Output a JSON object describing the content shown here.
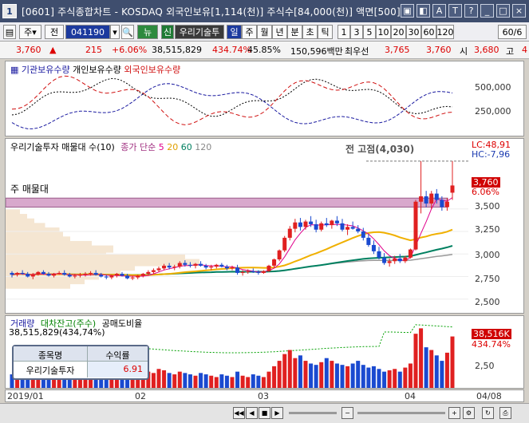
{
  "window": {
    "title": "[0601] 주식종합차트 - KOSDAQ 외국인보유[1,114(천)] 주식수[84,000(천)] 액면[500]",
    "app_badge": "1",
    "buttons": [
      "▣",
      "◧",
      "A",
      "T",
      "?",
      "_",
      "□",
      "×"
    ]
  },
  "toolbar": {
    "market": "주",
    "period_type": "전",
    "code": "041190",
    "name_badge": "뉴",
    "shin": "신",
    "stock_name": "우리기술투",
    "intervals": [
      "일",
      "주",
      "월",
      "년",
      "분",
      "초",
      "틱"
    ],
    "numbers": [
      "1",
      "3",
      "5",
      "10",
      "20",
      "30",
      "60",
      "120"
    ],
    "count": "60/6"
  },
  "info": {
    "price": "3,760",
    "arrow": "▲",
    "change": "215",
    "pct": "+6.06%",
    "volume": "38,515,829",
    "vol_ratio": "434.74%",
    "rate": "45.85%",
    "amount": "150,596백만",
    "priority_label": "최우선",
    "ask": "3,765",
    "bid": "3,760",
    "open_label": "시",
    "open": "3,680",
    "high_label": "고",
    "high": "4"
  },
  "ownership": {
    "legend_inst": "기관보유수량",
    "legend_indiv": "개인보유수량",
    "legend_foreign": "외국인보유수량",
    "y_ticks": [
      "500,000",
      "250,000"
    ],
    "colors": {
      "inst": "#1a1aa0",
      "indiv": "#000000",
      "foreign": "#d01010"
    }
  },
  "price_panel": {
    "legend_name": "우리기술투자 매물대 수(10)",
    "legend_ma": "종가 단순",
    "ma_periods": [
      "5",
      "20",
      "60",
      "120"
    ],
    "ma_colors": [
      "#e0008c",
      "#f0b000",
      "#008060",
      "#888888"
    ],
    "prev_high": "전 고점(4,030)",
    "lc": "LC:48,91",
    "hc": "HC:-7,96",
    "highlight_label": "주 매물대",
    "current_price": "3,760",
    "current_pct": "6.06%",
    "y_ticks": [
      "3,500",
      "3,250",
      "3,000",
      "2,750",
      "2,500"
    ]
  },
  "volume_panel": {
    "legend_vol": "거래량",
    "legend_loan": "대차잔고(주수)",
    "legend_short": "공매도비율",
    "vol_summary": "38,515,829(434,74%)",
    "current_vol": "38,516K",
    "current_pct": "434.74%",
    "y_tick": "2,50",
    "table_header": [
      "종목명",
      "수익률"
    ],
    "table_row": [
      "우리기술투자",
      "6.91"
    ]
  },
  "x_axis": [
    "2019/01",
    "02",
    "03",
    "04",
    "04/08"
  ],
  "chart_data": {
    "type": "candlestick",
    "ohlc": [
      [
        2790,
        2810,
        2740,
        2770
      ],
      [
        2770,
        2800,
        2750,
        2790
      ],
      [
        2790,
        2820,
        2770,
        2780
      ],
      [
        2780,
        2800,
        2740,
        2750
      ],
      [
        2750,
        2790,
        2720,
        2770
      ],
      [
        2770,
        2810,
        2760,
        2800
      ],
      [
        2800,
        2820,
        2770,
        2780
      ],
      [
        2780,
        2800,
        2750,
        2760
      ],
      [
        2760,
        2790,
        2740,
        2780
      ],
      [
        2780,
        2810,
        2770,
        2790
      ],
      [
        2790,
        2820,
        2760,
        2770
      ],
      [
        2770,
        2790,
        2740,
        2750
      ],
      [
        2750,
        2780,
        2730,
        2760
      ],
      [
        2760,
        2790,
        2740,
        2770
      ],
      [
        2770,
        2800,
        2750,
        2780
      ],
      [
        2780,
        2810,
        2760,
        2790
      ],
      [
        2790,
        2820,
        2760,
        2770
      ],
      [
        2770,
        2790,
        2740,
        2750
      ],
      [
        2750,
        2770,
        2720,
        2740
      ],
      [
        2740,
        2770,
        2720,
        2760
      ],
      [
        2760,
        2790,
        2740,
        2780
      ],
      [
        2780,
        2800,
        2750,
        2760
      ],
      [
        2760,
        2780,
        2720,
        2730
      ],
      [
        2730,
        2760,
        2710,
        2740
      ],
      [
        2740,
        2770,
        2720,
        2760
      ],
      [
        2760,
        2790,
        2740,
        2780
      ],
      [
        2780,
        2820,
        2760,
        2800
      ],
      [
        2800,
        2840,
        2780,
        2820
      ],
      [
        2820,
        2860,
        2800,
        2840
      ],
      [
        2840,
        2890,
        2820,
        2870
      ],
      [
        2870,
        2900,
        2830,
        2850
      ],
      [
        2850,
        2880,
        2820,
        2860
      ],
      [
        2860,
        2920,
        2840,
        2900
      ],
      [
        2900,
        2930,
        2860,
        2880
      ],
      [
        2880,
        2910,
        2850,
        2870
      ],
      [
        2870,
        2900,
        2840,
        2890
      ],
      [
        2890,
        2920,
        2860,
        2870
      ],
      [
        2870,
        2890,
        2830,
        2850
      ],
      [
        2850,
        2880,
        2820,
        2860
      ],
      [
        2860,
        2890,
        2840,
        2880
      ],
      [
        2880,
        2900,
        2850,
        2860
      ],
      [
        2860,
        2880,
        2820,
        2840
      ],
      [
        2840,
        2870,
        2820,
        2850
      ],
      [
        2850,
        2880,
        2770,
        2790
      ],
      [
        2790,
        2820,
        2760,
        2800
      ],
      [
        2800,
        2830,
        2780,
        2810
      ],
      [
        2810,
        2840,
        2790,
        2800
      ],
      [
        2800,
        2820,
        2770,
        2790
      ],
      [
        2790,
        2820,
        2780,
        2810
      ],
      [
        2810,
        2880,
        2800,
        2870
      ],
      [
        2870,
        2950,
        2850,
        2940
      ],
      [
        2940,
        3050,
        2920,
        3040
      ],
      [
        3040,
        3200,
        3020,
        3180
      ],
      [
        3180,
        3310,
        3150,
        3280
      ],
      [
        3280,
        3390,
        3240,
        3350
      ],
      [
        3350,
        3400,
        3260,
        3300
      ],
      [
        3300,
        3380,
        3270,
        3360
      ],
      [
        3360,
        3420,
        3300,
        3330
      ],
      [
        3330,
        3380,
        3240,
        3270
      ],
      [
        3270,
        3360,
        3250,
        3340
      ],
      [
        3340,
        3400,
        3300,
        3320
      ],
      [
        3320,
        3380,
        3280,
        3370
      ],
      [
        3370,
        3420,
        3310,
        3340
      ],
      [
        3340,
        3390,
        3250,
        3270
      ],
      [
        3270,
        3330,
        3210,
        3300
      ],
      [
        3300,
        3360,
        3270,
        3280
      ],
      [
        3280,
        3320,
        3230,
        3250
      ],
      [
        3250,
        3290,
        3150,
        3180
      ],
      [
        3180,
        3220,
        3080,
        3100
      ],
      [
        3100,
        3150,
        3000,
        3030
      ],
      [
        3030,
        3080,
        2940,
        2960
      ],
      [
        2960,
        3010,
        2880,
        2900
      ],
      [
        2900,
        2950,
        2860,
        2920
      ],
      [
        2920,
        2980,
        2890,
        2950
      ],
      [
        2950,
        3000,
        2900,
        2920
      ],
      [
        2920,
        2980,
        2900,
        2960
      ],
      [
        2960,
        3060,
        2950,
        3050
      ],
      [
        3050,
        3600,
        3040,
        3580
      ],
      [
        3580,
        4030,
        3450,
        3640
      ],
      [
        3640,
        3700,
        3520,
        3560
      ],
      [
        3560,
        3700,
        3500,
        3670
      ],
      [
        3670,
        3720,
        3560,
        3600
      ],
      [
        3600,
        3640,
        3480,
        3520
      ],
      [
        3520,
        3620,
        3480,
        3580
      ],
      [
        3680,
        4030,
        3600,
        3760
      ]
    ],
    "volume": [
      10,
      8,
      12,
      9,
      7,
      11,
      8,
      6,
      9,
      10,
      7,
      8,
      6,
      7,
      9,
      8,
      10,
      7,
      6,
      8,
      9,
      7,
      6,
      8,
      9,
      10,
      12,
      11,
      14,
      13,
      11,
      10,
      12,
      11,
      10,
      9,
      11,
      10,
      9,
      8,
      10,
      9,
      8,
      12,
      9,
      8,
      10,
      9,
      8,
      12,
      16,
      20,
      25,
      28,
      22,
      24,
      20,
      18,
      17,
      19,
      22,
      20,
      18,
      17,
      16,
      18,
      20,
      17,
      15,
      16,
      14,
      12,
      13,
      14,
      12,
      15,
      18,
      40,
      44,
      30,
      28,
      24,
      20,
      26,
      38
    ],
    "ylim": [
      2400,
      4100
    ],
    "x_labels": [
      "2019/01",
      "02",
      "03",
      "04",
      "04/08"
    ]
  }
}
